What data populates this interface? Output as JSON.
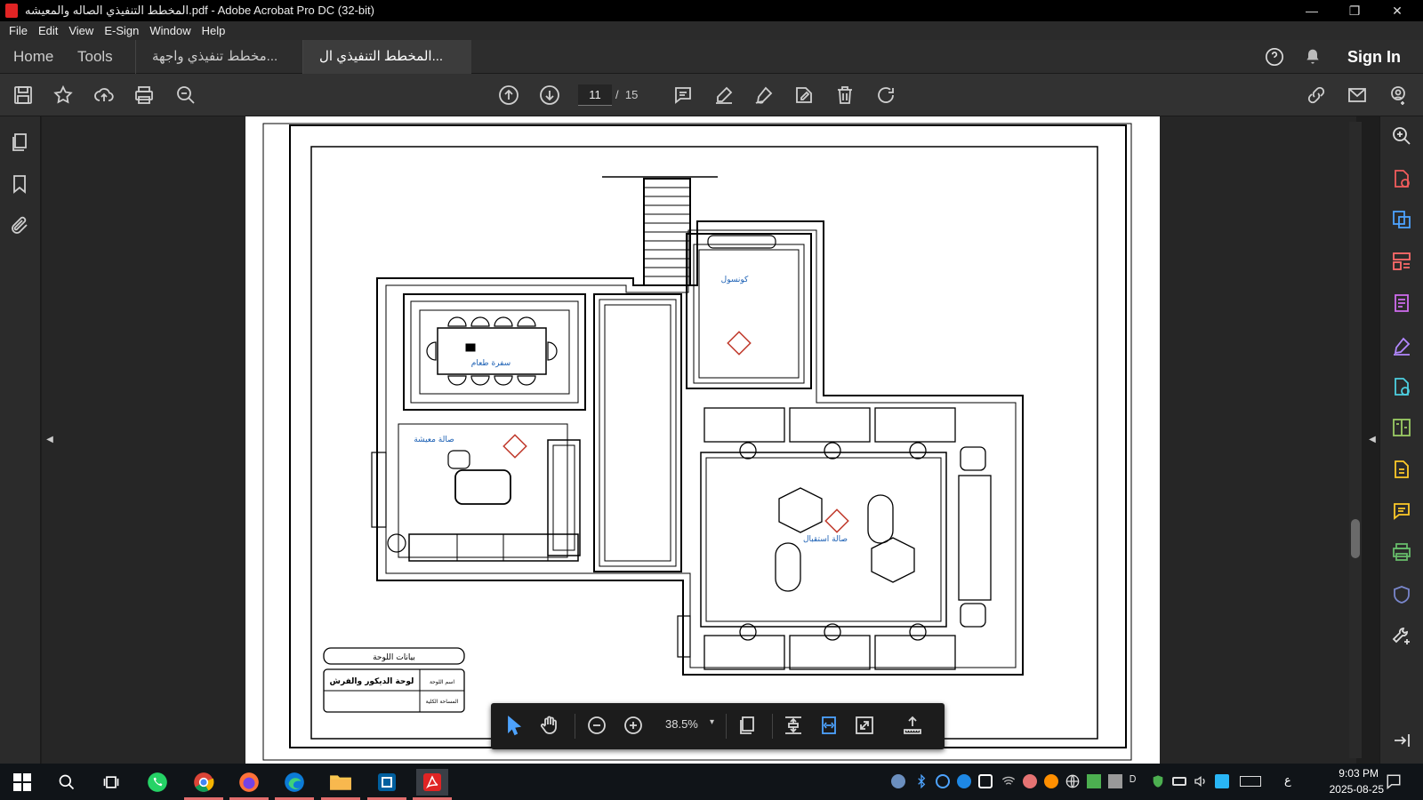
{
  "window": {
    "title": "المخطط التنفيذي الصاله والمعيشه.pdf - Adobe Acrobat Pro DC (32-bit)",
    "minimize": "—",
    "restore": "❐",
    "close": "✕"
  },
  "menu": [
    "File",
    "Edit",
    "View",
    "E-Sign",
    "Window",
    "Help"
  ],
  "nav": {
    "home": "Home",
    "tools": "Tools",
    "sign_in": "Sign In"
  },
  "tabs": [
    {
      "label": "مخطط تنفيذي واجهة...",
      "active": false
    },
    {
      "label": "المخطط التنفيذي ال...",
      "active": true,
      "close": "×"
    }
  ],
  "toolbar": {
    "current_page": "11",
    "page_separator": "/",
    "total_pages": "15"
  },
  "floating_toolbar": {
    "zoom": "38.5%",
    "zoom_dropdown": "▾"
  },
  "plan": {
    "rooms": {
      "dining": "سفرة طعام",
      "living": "صالة معيشة",
      "console": "كونسول",
      "reception": "صالة استقبال"
    },
    "titleblock": {
      "header": "بيانات اللوحة",
      "sheet_name_label": "اسم اللوحة",
      "sheet_name": "لوحة الديكور والفرش",
      "area_label": "المساحة الكلية"
    }
  },
  "taskbar": {
    "time": "9:03 PM",
    "date": "2025-08-25",
    "lang": "ع"
  },
  "colors": {
    "accent": "#1a5fb4",
    "pdf_red": "#e02424",
    "tool_purple": "#b388ff"
  }
}
